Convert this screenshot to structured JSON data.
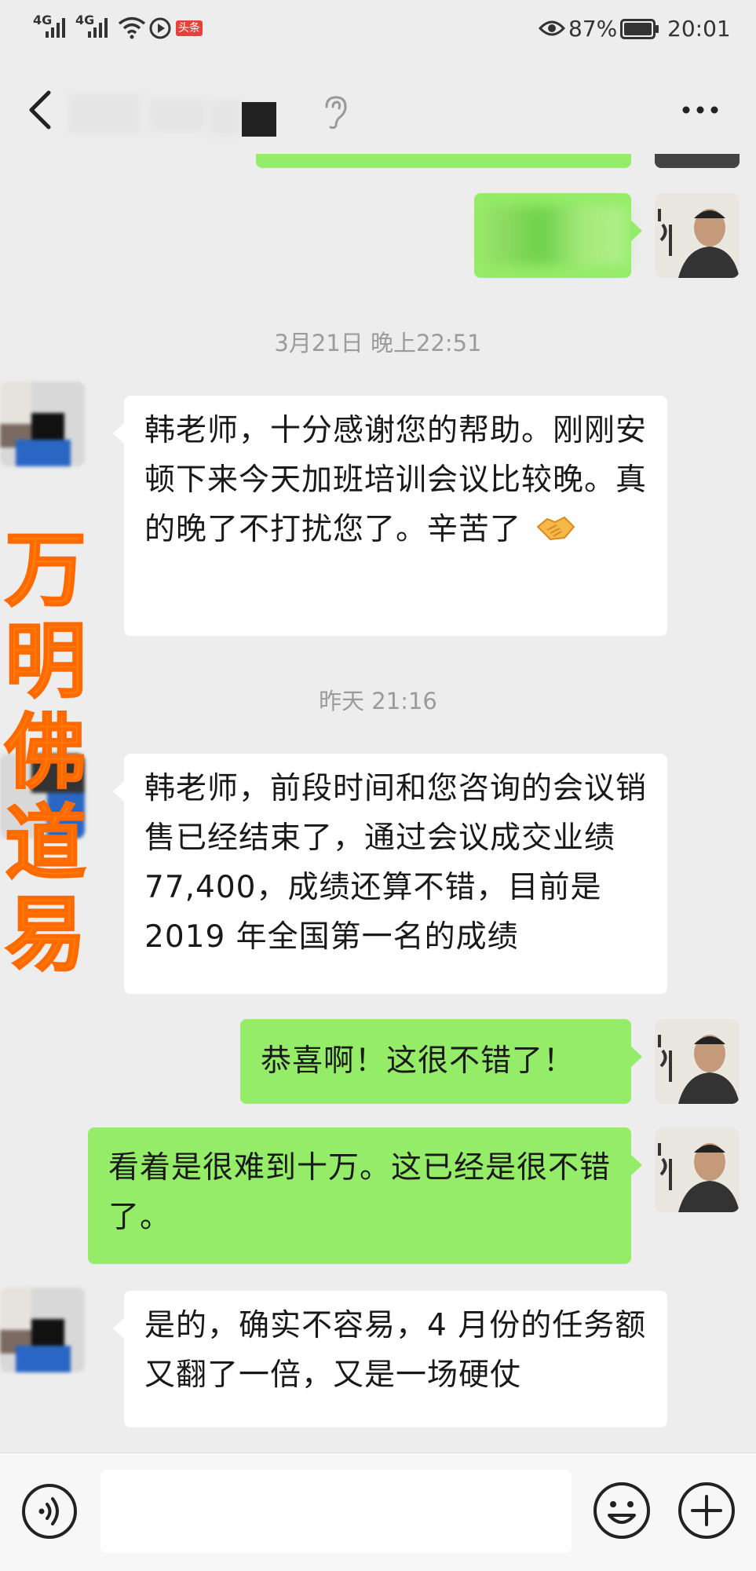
{
  "status_bar": {
    "signal1": "4G",
    "signal2": "4G",
    "badge": "头条",
    "battery": "87%",
    "time": "20:01"
  },
  "title_bar": {
    "icons": [
      "back-icon",
      "ear-icon",
      "more-icon"
    ]
  },
  "watermark": {
    "chars": [
      "万",
      "明",
      "佛",
      "道",
      "易"
    ]
  },
  "timestamps": {
    "t1": "3月21日 晚上22:51",
    "t2": "昨天 21:16"
  },
  "messages": {
    "m1": "韩老师，十分感谢您的帮助。刚刚安顿下来今天加班培训会议比较晚。真的晚了不打扰您了。辛苦了",
    "m2": "韩老师，前段时间和您咨询的会议销售已经结束了，通过会议成交业绩 77,400，成绩还算不错，目前是 2019 年全国第一名的成绩",
    "m3": "恭喜啊！这很不错了！",
    "m4": "看着是很难到十万。这已经是很不错了。",
    "m5": "是的，确实不容易，4 月份的任务额又翻了一倍，又是一场硬仗"
  },
  "colors": {
    "bubble_self": "#95ec69",
    "bubble_other": "#ffffff",
    "background": "#ededed",
    "watermark": "#ff7b0a"
  }
}
